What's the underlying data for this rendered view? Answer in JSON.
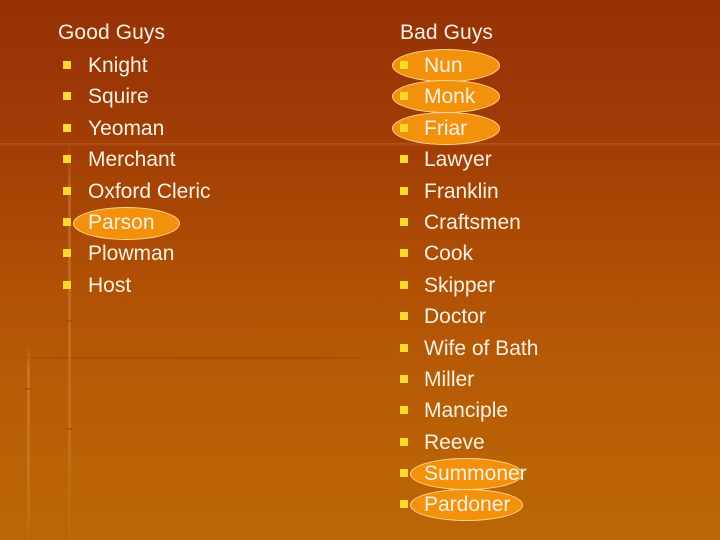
{
  "slide": {
    "background": {
      "top_color": "#963105",
      "bottom_color": "#bb6606",
      "accent_bullet_color": "#ffd92b",
      "text_color": "#f7f2e3",
      "highlight_fill": "#f3900c",
      "highlight_border": "#ffd98a"
    },
    "columns": [
      {
        "id": "good",
        "heading": "Good Guys",
        "items": [
          {
            "label": "Knight",
            "highlighted": false
          },
          {
            "label": "Squire",
            "highlighted": false
          },
          {
            "label": "Yeoman",
            "highlighted": false
          },
          {
            "label": "Merchant",
            "highlighted": false
          },
          {
            "label": "Oxford Cleric",
            "highlighted": false
          },
          {
            "label": "Parson",
            "highlighted": true
          },
          {
            "label": "Plowman",
            "highlighted": false
          },
          {
            "label": "Host",
            "highlighted": false
          }
        ]
      },
      {
        "id": "bad",
        "heading": "Bad Guys",
        "items": [
          {
            "label": "Nun",
            "highlighted": true
          },
          {
            "label": "Monk",
            "highlighted": true
          },
          {
            "label": "Friar",
            "highlighted": true
          },
          {
            "label": "Lawyer",
            "highlighted": false
          },
          {
            "label": "Franklin",
            "highlighted": false
          },
          {
            "label": "Craftsmen",
            "highlighted": false
          },
          {
            "label": "Cook",
            "highlighted": false
          },
          {
            "label": "Skipper",
            "highlighted": false
          },
          {
            "label": "Doctor",
            "highlighted": false
          },
          {
            "label": "Wife of Bath",
            "highlighted": false
          },
          {
            "label": "Miller",
            "highlighted": false
          },
          {
            "label": "Manciple",
            "highlighted": false
          },
          {
            "label": "Reeve",
            "highlighted": false
          },
          {
            "label": "Summoner",
            "highlighted": true
          },
          {
            "label": "Pardoner",
            "highlighted": true
          }
        ]
      }
    ]
  }
}
